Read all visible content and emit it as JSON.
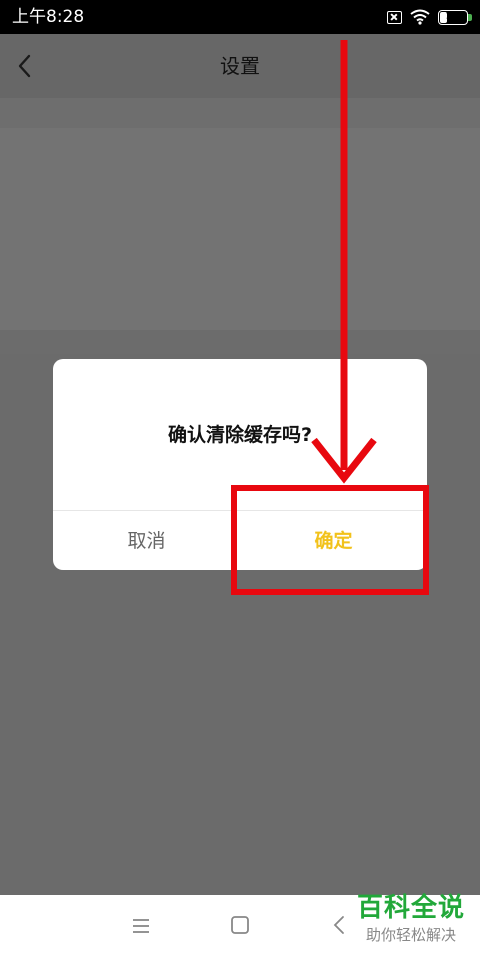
{
  "status_bar": {
    "time": "上午8:28",
    "battery_level": "25",
    "icons": [
      "sim-off-icon",
      "wifi-icon",
      "battery-icon"
    ]
  },
  "header": {
    "title": "设置",
    "back_icon": "chevron-left-icon"
  },
  "dialog": {
    "message": "确认清除缓存吗?",
    "cancel_label": "取消",
    "confirm_label": "确定"
  },
  "nav_bar": {
    "icons": [
      "menu-icon",
      "home-icon",
      "back-icon"
    ]
  },
  "watermark": {
    "brand": "百科全说",
    "slogan": "助你轻松解决"
  },
  "colors": {
    "confirm": "#f2c21b",
    "annotation": "#e8080f",
    "overlay": "#6b6b6b",
    "watermark": "#22a83a"
  }
}
